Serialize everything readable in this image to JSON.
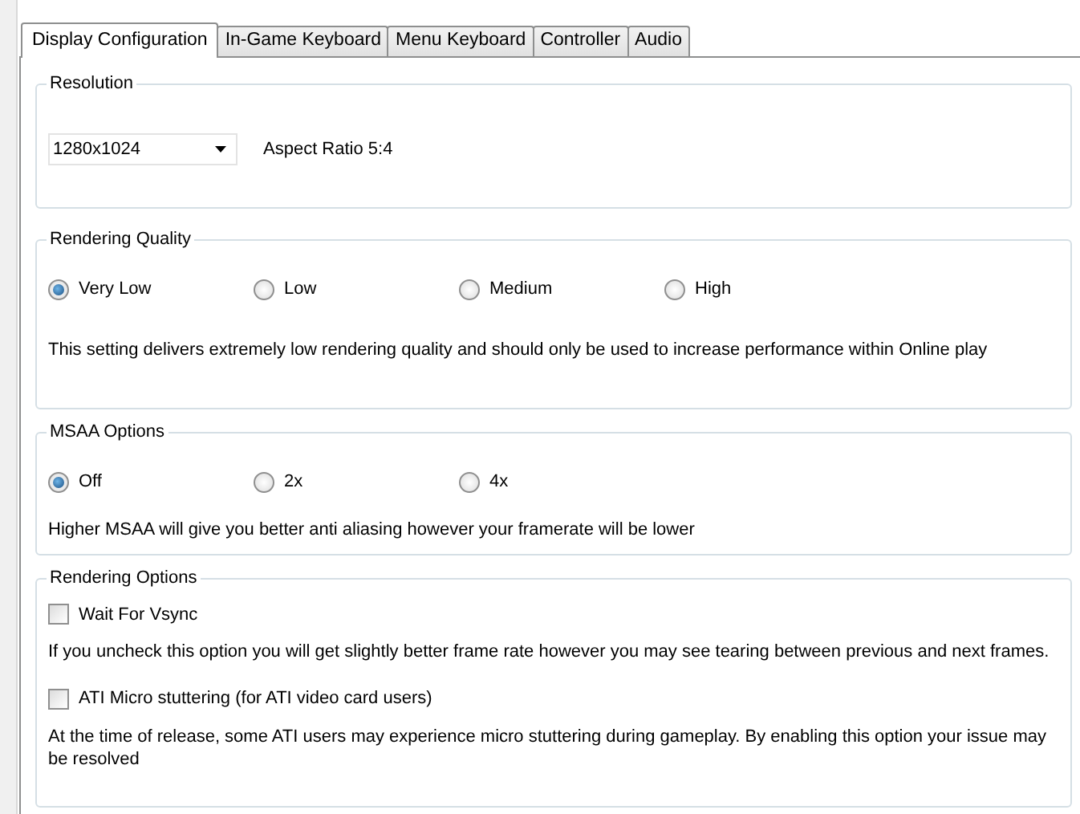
{
  "tabs": [
    {
      "label": "Display Configuration",
      "selected": true
    },
    {
      "label": "In-Game Keyboard",
      "selected": false
    },
    {
      "label": "Menu Keyboard",
      "selected": false
    },
    {
      "label": "Controller",
      "selected": false
    },
    {
      "label": "Audio",
      "selected": false
    }
  ],
  "groups": [
    {
      "kind": "resolution",
      "title": "Resolution",
      "dropdown": {
        "value": "1280x1024"
      },
      "aspect_label": "Aspect Ratio 5:4"
    },
    {
      "kind": "radio",
      "title": "Rendering Quality",
      "options": [
        {
          "label": "Very Low",
          "selected": true
        },
        {
          "label": "Low",
          "selected": false
        },
        {
          "label": "Medium",
          "selected": false
        },
        {
          "label": "High",
          "selected": false
        }
      ],
      "description": "This setting delivers extremely low rendering quality and should only be used to increase performance within Online play"
    },
    {
      "kind": "radio",
      "title": "MSAA Options",
      "options": [
        {
          "label": "Off",
          "selected": true
        },
        {
          "label": "2x",
          "selected": false
        },
        {
          "label": "4x",
          "selected": false
        }
      ],
      "description": "Higher MSAA will give you better anti aliasing however your framerate will be lower"
    },
    {
      "kind": "checkbox",
      "title": "Rendering Options",
      "options": [
        {
          "label": "Wait For Vsync",
          "checked": false,
          "description": "If you uncheck this option you will get slightly better frame rate however you may see tearing between previous and next frames."
        },
        {
          "label": "ATI Micro stuttering (for ATI video card users)",
          "checked": false,
          "description": "At the time of release, some ATI users may experience micro stuttering during gameplay. By enabling this option your issue may be resolved"
        }
      ]
    }
  ]
}
